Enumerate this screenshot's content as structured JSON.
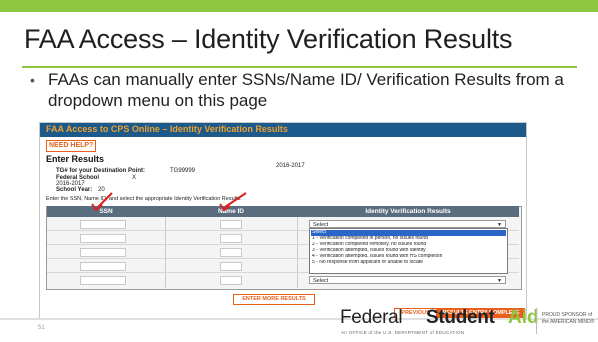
{
  "slide": {
    "title": "FAA Access – Identity Verification Results",
    "bullet": "FAAs can manually enter SSNs/Name ID/ Verification Results from a dropdown menu on this page",
    "number": "51"
  },
  "screenshot": {
    "header": "FAA Access to CPS Online – Identity Verification Results",
    "need_help": "NEED HELP?",
    "section_title": "Enter Results",
    "fields": {
      "tg_label": "TG# for your Destination Point:",
      "tg_value": "TG99999",
      "school_label": "Federal School",
      "school_value": "2016-2017",
      "school_x": "X",
      "year_label": "School Year:",
      "year_value": "20",
      "award_year": "2016-2017"
    },
    "instruction": "Enter the SSN, Name ID, and select the appropriate Identity Verification Results.",
    "columns": [
      "SSN",
      "Name ID",
      "Identity Verification Results"
    ],
    "select_default": "Select",
    "dropdown_options": [
      "Select",
      "1 - Verification completed in person, no issues found",
      "2 - Verification completed remotely, no issues found",
      "3 - Verification attempted, issues found with identity",
      "4 - Verification attempted, issues found with HS completion",
      "5 - No response from applicant or unable to locate"
    ],
    "enter_more": "ENTER MORE RESULTS",
    "previous": "PREVIOUS",
    "complete": "RESULTS ENTRY COMPLETE"
  },
  "footer": {
    "brand_federal": "Federal",
    "brand_student": "Student",
    "brand_aid": "Aid",
    "tagline": "An OFFICE of the U.S. DEPARTMENT of EDUCATION",
    "sponsor_line1": "PROUD SPONSOR of",
    "sponsor_line2": "the AMERICAN MIND®"
  },
  "colors": {
    "accent_green": "#8ec63f",
    "header_blue": "#1b5a8a",
    "orange": "#e8601c",
    "arrow_red": "#e02020"
  }
}
